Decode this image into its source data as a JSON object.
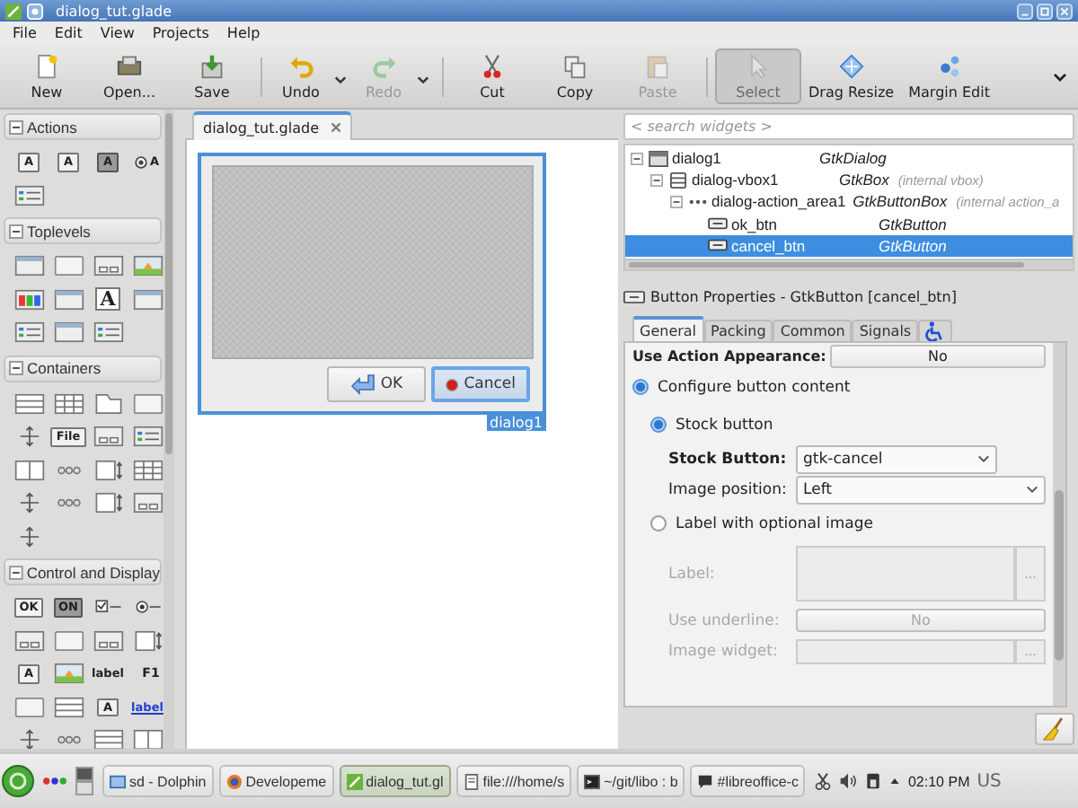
{
  "window": {
    "title": "dialog_tut.glade"
  },
  "menu": [
    "File",
    "Edit",
    "View",
    "Projects",
    "Help"
  ],
  "toolbar": {
    "groups": [
      {
        "items": [
          {
            "label": "New",
            "kind": "new",
            "disabled": false,
            "active": false,
            "dropdown": false
          },
          {
            "label": "Open...",
            "kind": "open",
            "disabled": false,
            "active": false,
            "dropdown": false
          },
          {
            "label": "Save",
            "kind": "save",
            "disabled": false,
            "active": false,
            "dropdown": false
          }
        ]
      },
      {
        "items": [
          {
            "label": "Undo",
            "kind": "undo",
            "disabled": false,
            "active": false,
            "dropdown": true
          },
          {
            "label": "Redo",
            "kind": "redo",
            "disabled": true,
            "active": false,
            "dropdown": true
          }
        ]
      },
      {
        "items": [
          {
            "label": "Cut",
            "kind": "cut",
            "disabled": false,
            "active": false,
            "dropdown": false
          },
          {
            "label": "Copy",
            "kind": "copy",
            "disabled": false,
            "active": false,
            "dropdown": false
          },
          {
            "label": "Paste",
            "kind": "paste",
            "disabled": true,
            "active": false,
            "dropdown": false
          }
        ]
      },
      {
        "items": [
          {
            "label": "Select",
            "kind": "select",
            "disabled": true,
            "active": true,
            "dropdown": false
          },
          {
            "label": "Drag Resize",
            "kind": "drag",
            "disabled": false,
            "active": false,
            "dropdown": false
          },
          {
            "label": "Margin Edit",
            "kind": "margin",
            "disabled": false,
            "active": false,
            "dropdown": false
          }
        ]
      }
    ]
  },
  "palette": {
    "groups": [
      {
        "title": "Actions",
        "expanded": true,
        "items": [
          {
            "kind": "boxed",
            "text": "A"
          },
          {
            "kind": "boxed",
            "text": "A"
          },
          {
            "kind": "dark",
            "text": "A"
          },
          {
            "kind": "radio",
            "text": "A"
          },
          {
            "kind": "list"
          }
        ]
      },
      {
        "title": "Toplevels",
        "expanded": true,
        "items": [
          {
            "kind": "window"
          },
          {
            "kind": "frame"
          },
          {
            "kind": "pair"
          },
          {
            "kind": "image"
          },
          {
            "kind": "palette"
          },
          {
            "kind": "window"
          },
          {
            "kind": "serif",
            "text": "A"
          },
          {
            "kind": "window"
          },
          {
            "kind": "list"
          },
          {
            "kind": "window"
          },
          {
            "kind": "list"
          }
        ]
      },
      {
        "title": "Containers",
        "expanded": true,
        "items": [
          {
            "kind": "hbox"
          },
          {
            "kind": "grid"
          },
          {
            "kind": "notebook"
          },
          {
            "kind": "frame"
          },
          {
            "kind": "move"
          },
          {
            "kind": "boxed",
            "text": "File"
          },
          {
            "kind": "pair"
          },
          {
            "kind": "list"
          },
          {
            "kind": "paned"
          },
          {
            "kind": "dots"
          },
          {
            "kind": "scroll"
          },
          {
            "kind": "grid"
          },
          {
            "kind": "move"
          },
          {
            "kind": "dots"
          },
          {
            "kind": "scroll"
          },
          {
            "kind": "pair"
          },
          {
            "kind": "move"
          }
        ]
      },
      {
        "title": "Control and Display",
        "expanded": true,
        "items": [
          {
            "kind": "boxed",
            "text": "OK"
          },
          {
            "kind": "dark",
            "text": "ON"
          },
          {
            "kind": "check"
          },
          {
            "kind": "radio"
          },
          {
            "kind": "pair"
          },
          {
            "kind": "frame"
          },
          {
            "kind": "pair"
          },
          {
            "kind": "scroll"
          },
          {
            "kind": "boxed",
            "text": "A"
          },
          {
            "kind": "image"
          },
          {
            "kind": "bare",
            "text": "label"
          },
          {
            "kind": "accel",
            "text": "F1"
          },
          {
            "kind": "frame"
          },
          {
            "kind": "hbox"
          },
          {
            "kind": "boxed",
            "text": "A"
          },
          {
            "kind": "link",
            "text": "label"
          },
          {
            "kind": "move"
          },
          {
            "kind": "dots"
          },
          {
            "kind": "hbox"
          },
          {
            "kind": "paned"
          }
        ]
      }
    ]
  },
  "editor": {
    "tab": {
      "label": "dialog_tut.glade",
      "selected": true
    },
    "dialog": {
      "name": "dialog1",
      "buttons": [
        {
          "label": "OK",
          "kind": "arrow",
          "selected": false
        },
        {
          "label": "Cancel",
          "kind": "stop",
          "selected": true
        }
      ]
    }
  },
  "inspector": {
    "search": {
      "placeholder": "< search widgets >"
    },
    "tree": [
      {
        "name": "dialog1",
        "type": "GtkDialog",
        "kind": "window",
        "expanded": true,
        "selected": false,
        "children": [
          {
            "name": "dialog-vbox1",
            "type": "GtkBox",
            "note": "(internal vbox)",
            "kind": "vbox",
            "expanded": true,
            "selected": false,
            "children": [
              {
                "name": "dialog-action_area1",
                "type": "GtkButtonBox",
                "note": "(internal action_a",
                "kind": "dots",
                "expanded": true,
                "selected": false,
                "children": [
                  {
                    "name": "ok_btn",
                    "type": "GtkButton",
                    "kind": "button",
                    "selected": false
                  },
                  {
                    "name": "cancel_btn",
                    "type": "GtkButton",
                    "kind": "button",
                    "selected": true
                  }
                ]
              }
            ]
          }
        ]
      }
    ]
  },
  "properties": {
    "title": "Button Properties - GtkButton [cancel_btn]",
    "tabs": [
      {
        "kind": "text",
        "label": "General",
        "selected": true
      },
      {
        "kind": "text",
        "label": "Packing",
        "selected": false
      },
      {
        "kind": "text",
        "label": "Common",
        "selected": false
      },
      {
        "kind": "text",
        "label": "Signals",
        "selected": false
      },
      {
        "kind": "accessibility",
        "selected": false
      }
    ],
    "rows": [
      {
        "kind": "toggle",
        "label": "Use Action Appearance:",
        "value": "No",
        "bold": true,
        "disabled": false
      },
      {
        "kind": "radio",
        "label": "Configure button content",
        "checked": true,
        "disabled": false,
        "children": [
          {
            "kind": "radio",
            "label": "Stock button",
            "checked": true,
            "disabled": false,
            "children": [
              {
                "kind": "combo",
                "label": "Stock Button:",
                "value": "gtk-cancel",
                "bold": true,
                "disabled": false
              },
              {
                "kind": "combo",
                "label": "Image position:",
                "value": "Left",
                "bold": false,
                "disabled": false
              }
            ]
          },
          {
            "kind": "radio",
            "label": "Label with optional image",
            "checked": false,
            "disabled": false,
            "children": [
              {
                "kind": "textarea",
                "label": "Label:",
                "button": "...",
                "bold": false,
                "disabled": true
              },
              {
                "kind": "toggle",
                "label": "Use underline:",
                "value": "No",
                "bold": false,
                "disabled": true
              },
              {
                "kind": "entry",
                "label": "Image widget:",
                "button": "...",
                "bold": false,
                "disabled": true
              }
            ]
          }
        ]
      }
    ]
  },
  "taskbar": {
    "tasks": [
      {
        "label": "sd - Dolphin",
        "kind": "folder",
        "selected": false
      },
      {
        "label": "Developeme",
        "kind": "globe",
        "selected": false
      },
      {
        "label": "dialog_tut.gl",
        "kind": "glade",
        "selected": true
      },
      {
        "label": "file:///home/s",
        "kind": "doc",
        "selected": false
      },
      {
        "label": "~/git/libo : b",
        "kind": "terminal",
        "selected": false
      },
      {
        "label": "#libreoffice-c",
        "kind": "chat",
        "selected": false
      }
    ],
    "clock": "02:10 PM",
    "layout": "US"
  }
}
